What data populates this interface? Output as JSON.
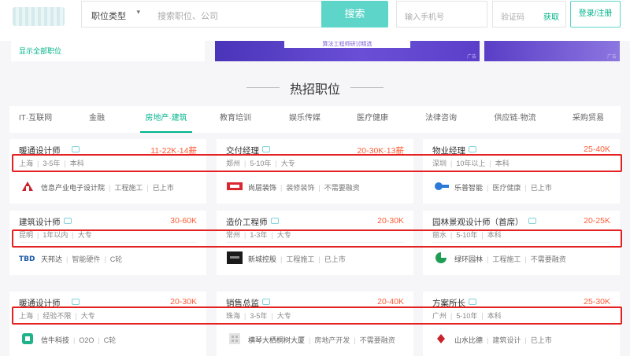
{
  "search": {
    "job_type": "职位类型",
    "placeholder": "搜索职位、公司",
    "button": "搜索",
    "phone_placeholder": "输入手机号",
    "code_placeholder": "验证码",
    "get_code": "获取",
    "login": "登录/注册"
  },
  "left_panel": {
    "show_all": "显示全部职位"
  },
  "banner": {
    "text": "算法工程师研讨精选",
    "ad_label": "广告",
    "side_ad_label": "广告"
  },
  "section_title": "热招职位",
  "tabs": [
    {
      "label": "IT·互联网"
    },
    {
      "label": "金融"
    },
    {
      "label": "房地产·建筑",
      "active": true
    },
    {
      "label": "教育培训"
    },
    {
      "label": "娱乐传媒"
    },
    {
      "label": "医疗健康"
    },
    {
      "label": "法律咨询"
    },
    {
      "label": "供应链·物流"
    },
    {
      "label": "采购贸易"
    }
  ],
  "jobs": [
    {
      "title": "暖通设计师",
      "salary": "11-22K·14薪",
      "city": "上海",
      "exp": "3-5年",
      "edu": "本科",
      "company": "信息产业电子设计院",
      "tag1": "工程施工",
      "tag2": "已上市"
    },
    {
      "title": "交付经理",
      "salary": "20-30K·13薪",
      "city": "郑州",
      "exp": "5-10年",
      "edu": "大专",
      "company": "尚层装饰",
      "tag1": "装修装饰",
      "tag2": "不需要融资"
    },
    {
      "title": "物业经理",
      "salary": "25-40K",
      "city": "深圳",
      "exp": "10年以上",
      "edu": "本科",
      "company": "乐普智能",
      "tag1": "医疗健康",
      "tag2": "已上市"
    },
    {
      "title": "建筑设计师",
      "salary": "30-60K",
      "city": "昆明",
      "exp": "1年以内",
      "edu": "大专",
      "company": "天邦达",
      "tag1": "智能硬件",
      "tag2": "C轮"
    },
    {
      "title": "造价工程师",
      "salary": "20-30K",
      "city": "常州",
      "exp": "1-3年",
      "edu": "大专",
      "company": "新城控股",
      "tag1": "工程施工",
      "tag2": "已上市"
    },
    {
      "title": "园林景观设计师（首席）",
      "salary": "20-25K",
      "city": "丽水",
      "exp": "5-10年",
      "edu": "本科",
      "company": "绿环园林",
      "tag1": "工程施工",
      "tag2": "不需要融资"
    },
    {
      "title": "暖通设计师",
      "salary": "20-30K",
      "city": "上海",
      "exp": "经验不限",
      "edu": "大专",
      "company": "信牛科技",
      "tag1": "O2O",
      "tag2": "C轮"
    },
    {
      "title": "销售总监",
      "salary": "20-40K",
      "city": "珠海",
      "exp": "3-5年",
      "edu": "大专",
      "company": "横琴大栖桐树大厦",
      "tag1": "房地产开发",
      "tag2": "不需要融资"
    },
    {
      "title": "方案所长",
      "salary": "25-30K",
      "city": "广州",
      "exp": "5-10年",
      "edu": "本科",
      "company": "山水比德",
      "tag1": "建筑设计",
      "tag2": "已上市"
    }
  ],
  "colors": {
    "accent": "#00b38a",
    "salary": "#fd5f39",
    "highlight": "#e52020",
    "search_button": "#5dd5c8"
  }
}
